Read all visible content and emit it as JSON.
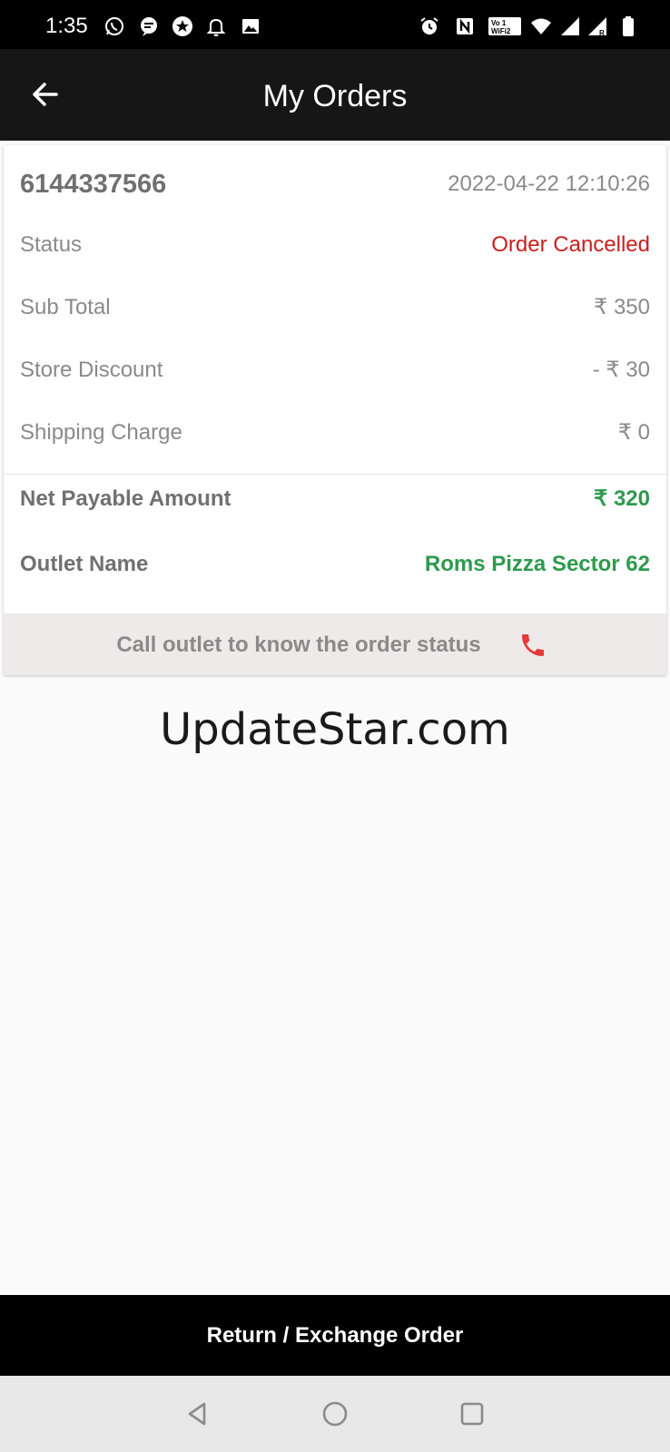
{
  "status_bar": {
    "time": "1:35",
    "left_icons": [
      "whatsapp-icon",
      "messages-icon",
      "star-icon",
      "bell-icon",
      "image-icon"
    ],
    "right_icons": [
      "alarm-icon",
      "nfc-icon",
      "vowifi-icon",
      "wifi-icon",
      "signal-icon",
      "signal-roaming-icon",
      "battery-icon"
    ]
  },
  "app_bar": {
    "title": "My Orders",
    "back_icon": "arrow-left-icon"
  },
  "order": {
    "id": "6144337566",
    "datetime": "2022-04-22 12:10:26",
    "rows": [
      {
        "label": "Status",
        "value": "Order Cancelled"
      },
      {
        "label": "Sub Total",
        "value": "₹ 350"
      },
      {
        "label": "Store Discount",
        "value": "- ₹ 30"
      },
      {
        "label": "Shipping Charge",
        "value": "₹ 0"
      }
    ],
    "net_payable": {
      "label": "Net Payable Amount",
      "value": "₹ 320"
    },
    "outlet": {
      "label": "Outlet Name",
      "value": "Roms Pizza Sector 62"
    },
    "call_text": "Call outlet to know the order status",
    "call_icon": "phone-icon"
  },
  "watermark": "UpdateStar.com",
  "bottom_button": "Return / Exchange Order",
  "nav_bar": {
    "icons": [
      "back-triangle-icon",
      "home-circle-icon",
      "recents-square-icon"
    ]
  },
  "colors": {
    "status_cancelled": "#c8201f",
    "amount_green": "#2e9a4e",
    "phone_red": "#e53935",
    "app_bar": "#161616"
  }
}
